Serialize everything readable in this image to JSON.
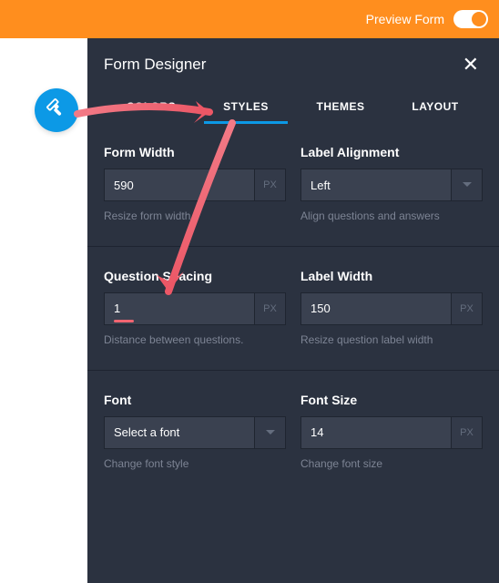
{
  "topbar": {
    "preview_label": "Preview Form"
  },
  "panel": {
    "title": "Form Designer"
  },
  "tabs": {
    "colors": "COLORS",
    "styles": "STYLES",
    "themes": "THEMES",
    "layout": "LAYOUT"
  },
  "fields": {
    "form_width": {
      "label": "Form Width",
      "value": "590",
      "unit": "PX",
      "hint": "Resize form width"
    },
    "label_alignment": {
      "label": "Label Alignment",
      "value": "Left",
      "hint": "Align questions and answers"
    },
    "question_spacing": {
      "label": "Question Spacing",
      "value": "1",
      "unit": "PX",
      "hint": "Distance between questions."
    },
    "label_width": {
      "label": "Label Width",
      "value": "150",
      "unit": "PX",
      "hint": "Resize question label width"
    },
    "font": {
      "label": "Font",
      "value": "Select a font",
      "hint": "Change font style"
    },
    "font_size": {
      "label": "Font Size",
      "value": "14",
      "unit": "PX",
      "hint": "Change font size"
    }
  }
}
